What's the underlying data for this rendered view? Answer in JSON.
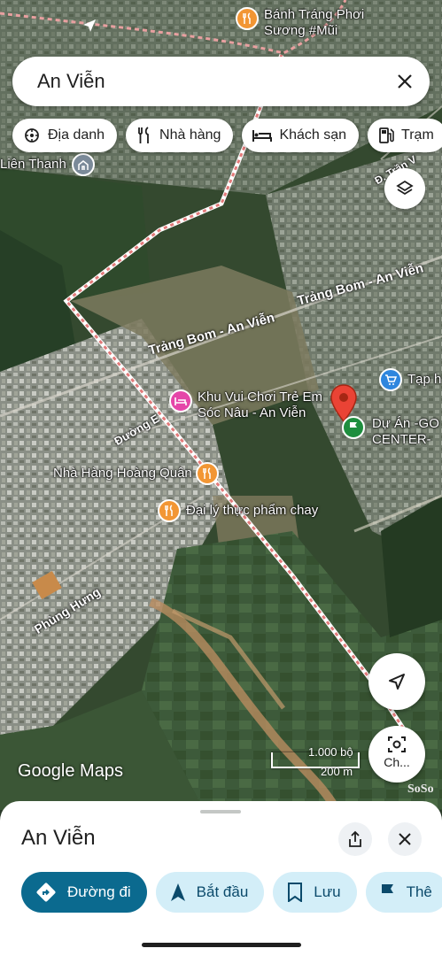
{
  "search": {
    "query": "An Viễn"
  },
  "chips": [
    {
      "label": "Địa danh",
      "icon": "landmark-icon"
    },
    {
      "label": "Nhà hàng",
      "icon": "restaurant-icon"
    },
    {
      "label": "Khách sạn",
      "icon": "hotel-icon"
    },
    {
      "label": "Trạm",
      "icon": "gas-station-icon"
    }
  ],
  "map": {
    "road_labels": [
      "Trảng Bom - An Viễn",
      "Trảng Bom - An Viễn",
      "Đường E",
      "Phùng Hưng",
      "Đ. Trần V"
    ],
    "pois": [
      {
        "name": "Bánh Tráng Phơi Sương #Mũi",
        "line1": "Bánh Tráng Phơi",
        "line2": "Sương #Mũi",
        "icon": "restaurant-icon"
      },
      {
        "name": "Liên Thanh",
        "icon": "church-icon"
      },
      {
        "name": "Khu Vui Chơi Trẻ Em Sóc Nâu - An Viễn",
        "line1": "Khu Vui Chơi Trẻ Em",
        "line2": "Sóc Nâu - An Viễn",
        "icon": "hotel-bed-icon"
      },
      {
        "name": "Tạp h",
        "icon": "shopping-cart-icon"
      },
      {
        "name": "Dự Án -GO CENTER-",
        "line1": "Dự Án -GO",
        "line2": "CENTER-",
        "icon": "flag-icon"
      },
      {
        "name": "Nhà Hàng Hoàng Quân",
        "icon": "restaurant-icon"
      },
      {
        "name": "Đại lý thực phẩm chay",
        "icon": "restaurant-icon"
      }
    ],
    "logo": "Google Maps",
    "scale": {
      "imperial": "1.000 bộ",
      "metric": "200 m"
    },
    "lens_label": "Ch...",
    "watermark": "SoSo"
  },
  "sheet": {
    "title": "An Viễn",
    "actions": [
      {
        "label": "Đường đi",
        "icon": "directions-icon"
      },
      {
        "label": "Bắt đầu",
        "icon": "navigation-arrow-icon"
      },
      {
        "label": "Lưu",
        "icon": "bookmark-icon"
      },
      {
        "label": "Thê",
        "icon": "flag-icon"
      }
    ]
  },
  "colors": {
    "primary": "#0b6a8f",
    "action_bg": "#d3eef8",
    "boundary": "#e8a0a0",
    "pin": "#ea4335"
  }
}
